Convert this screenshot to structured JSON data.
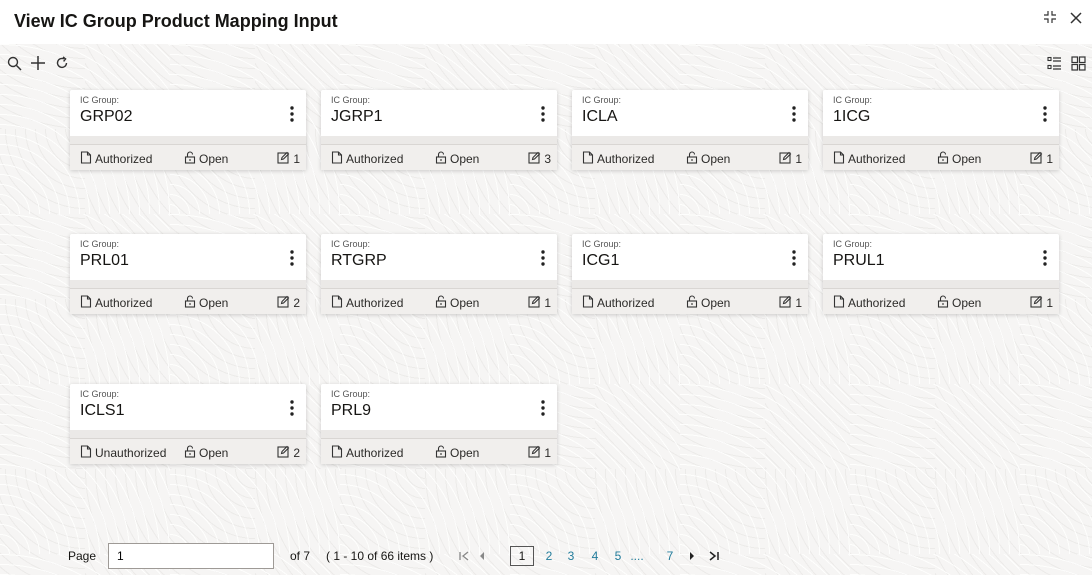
{
  "window": {
    "title": "View IC Group Product Mapping Input"
  },
  "card_label": "IC Group:",
  "cards": [
    {
      "value": "GRP02",
      "status": "Authorized",
      "lock": "Open",
      "version": "1"
    },
    {
      "value": "JGRP1",
      "status": "Authorized",
      "lock": "Open",
      "version": "3"
    },
    {
      "value": "ICLA",
      "status": "Authorized",
      "lock": "Open",
      "version": "1"
    },
    {
      "value": "1ICG",
      "status": "Authorized",
      "lock": "Open",
      "version": "1"
    },
    {
      "value": "PRL01",
      "status": "Authorized",
      "lock": "Open",
      "version": "2"
    },
    {
      "value": "RTGRP",
      "status": "Authorized",
      "lock": "Open",
      "version": "1"
    },
    {
      "value": "ICG1",
      "status": "Authorized",
      "lock": "Open",
      "version": "1"
    },
    {
      "value": "PRUL1",
      "status": "Authorized",
      "lock": "Open",
      "version": "1"
    },
    {
      "value": "ICLS1",
      "status": "Unauthorized",
      "lock": "Open",
      "version": "2"
    },
    {
      "value": "PRL9",
      "status": "Authorized",
      "lock": "Open",
      "version": "1"
    }
  ],
  "pager": {
    "page_label": "Page",
    "page_value": "1",
    "of_text": "of 7",
    "items_text": "( 1 - 10 of 66 items )",
    "pages": [
      "1",
      "2",
      "3",
      "4",
      "5",
      "....",
      "7"
    ]
  }
}
